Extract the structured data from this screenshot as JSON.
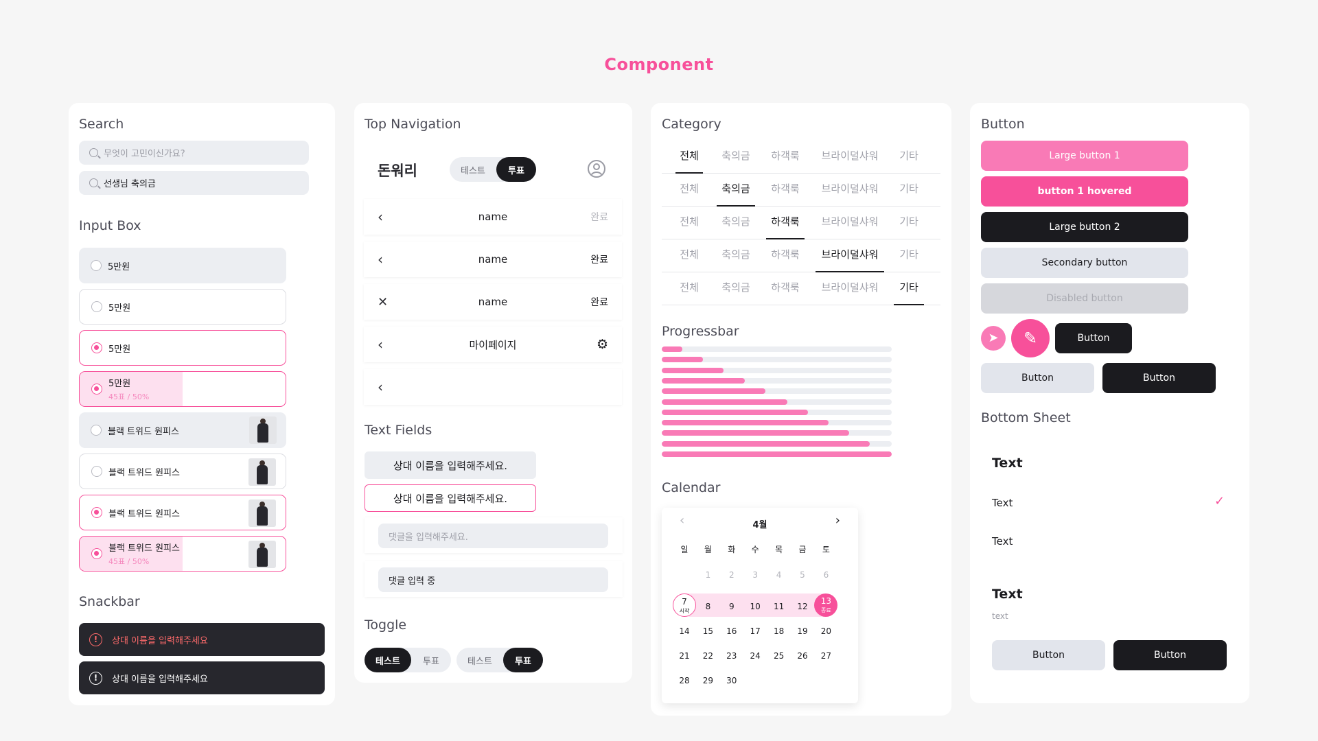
{
  "page": {
    "title": "Component"
  },
  "colors": {
    "accent": "#f7509a",
    "accent_light": "#f97ab6",
    "dark": "#1b1b1f",
    "gray_bg": "#eceef2"
  },
  "search": {
    "title": "Search",
    "placeholder": "무엇이 고민이신가요?",
    "value": "선생님 축의금"
  },
  "input_box": {
    "title": "Input Box",
    "options": [
      {
        "label": "5만원"
      },
      {
        "label": "5만원"
      },
      {
        "label": "5만원"
      },
      {
        "label": "5만원",
        "sub": "45표 / 50%",
        "vote_ratio": 0.5
      },
      {
        "label": "블랙 트위드 원피스"
      },
      {
        "label": "블랙 트위드 원피스"
      },
      {
        "label": "블랙 트위드 원피스"
      },
      {
        "label": "블랙 트위드 원피스",
        "sub": "45표 / 50%",
        "vote_ratio": 0.5
      }
    ]
  },
  "snackbar": {
    "title": "Snackbar",
    "items": [
      {
        "text": "상대 이름을 입력해주세요",
        "icon": "alert-circle-icon"
      },
      {
        "text": "상대 이름을 입력해주세요",
        "icon": "alert-circle-icon"
      }
    ]
  },
  "top_navigation": {
    "title": "Top Navigation",
    "brand": "돈워리",
    "tabs": [
      "테스트",
      "투표"
    ],
    "rows": [
      {
        "left_icon": "chevron-left-icon",
        "center": "name",
        "right": "완료"
      },
      {
        "left_icon": "chevron-left-icon",
        "center": "name",
        "right": "완료"
      },
      {
        "left_icon": "close-icon",
        "center": "name",
        "right": "완료"
      },
      {
        "left_icon": "chevron-left-icon",
        "center": "마이페이지",
        "right_icon": "gear-icon"
      },
      {
        "left_icon": "chevron-left-icon"
      }
    ]
  },
  "text_fields": {
    "title": "Text Fields",
    "fields": [
      "상대 이름을 입력해주세요.",
      "상대 이름을 입력해주세요."
    ],
    "comment_placeholder": "댓글을 입력해주세요.",
    "comment_value": "댓글 입력 중"
  },
  "toggle": {
    "title": "Toggle",
    "groups": [
      {
        "options": [
          "테스트",
          "투표"
        ],
        "selected": 0
      },
      {
        "options": [
          "테스트",
          "투표"
        ],
        "selected": 1
      }
    ]
  },
  "category": {
    "title": "Category",
    "items": [
      "전체",
      "축의금",
      "하객룩",
      "브라이덜샤워",
      "기타"
    ],
    "rows_selected": [
      0,
      1,
      2,
      3,
      4
    ]
  },
  "progressbar": {
    "title": "Progressbar",
    "values": [
      0.09,
      0.18,
      0.27,
      0.36,
      0.45,
      0.545,
      0.635,
      0.725,
      0.815,
      0.905,
      1.0
    ]
  },
  "calendar": {
    "title": "Calendar",
    "month": "4월",
    "weekdays": [
      "일",
      "월",
      "화",
      "수",
      "목",
      "금",
      "토"
    ],
    "weeks": [
      [
        "",
        "1",
        "2",
        "3",
        "4",
        "5",
        "6"
      ],
      [
        "7",
        "8",
        "9",
        "10",
        "11",
        "12",
        "13"
      ],
      [
        "14",
        "15",
        "16",
        "17",
        "18",
        "19",
        "20"
      ],
      [
        "21",
        "22",
        "23",
        "24",
        "25",
        "26",
        "27"
      ],
      [
        "28",
        "29",
        "30",
        "",
        "",
        "",
        ""
      ]
    ],
    "range_start": {
      "day": "7",
      "label": "시작"
    },
    "range_end": {
      "day": "13",
      "label": "종료"
    }
  },
  "button": {
    "title": "Button",
    "large1": "Large button 1",
    "hovered": "button 1 hovered",
    "large2": "Large button 2",
    "secondary": "Secondary button",
    "disabled": "Disabled button",
    "small": "Button",
    "pair_light": "Button",
    "pair_dark": "Button"
  },
  "bottom_sheet": {
    "title": "Bottom Sheet",
    "heading1": "Text",
    "item1": "Text",
    "item2": "Text",
    "heading2": "Text",
    "caption": "text",
    "btn_light": "Button",
    "btn_dark": "Button"
  }
}
